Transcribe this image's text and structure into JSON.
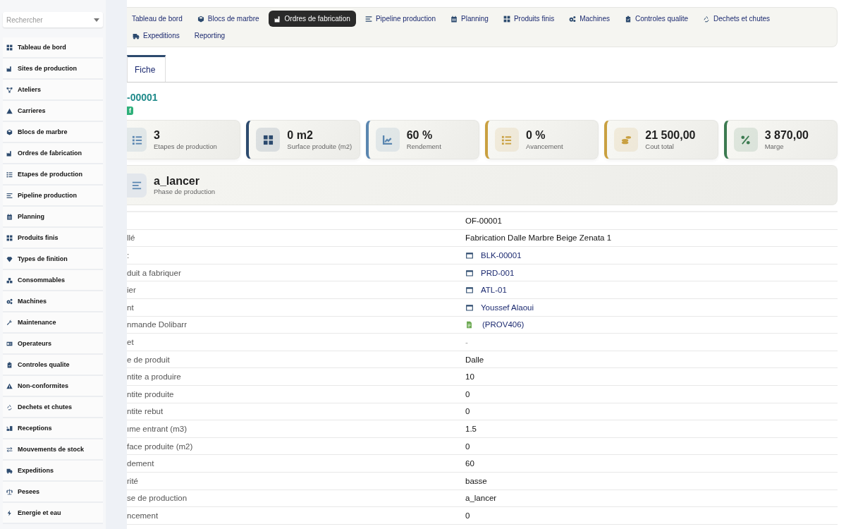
{
  "sidebar": {
    "search": {
      "placeholder": "Rechercher"
    },
    "items": [
      {
        "label": "Tableau de bord"
      },
      {
        "label": "Sites de production"
      },
      {
        "label": "Ateliers"
      },
      {
        "label": "Carrieres"
      },
      {
        "label": "Blocs de marbre"
      },
      {
        "label": "Ordres de fabrication"
      },
      {
        "label": "Etapes de production"
      },
      {
        "label": "Pipeline production"
      },
      {
        "label": "Planning"
      },
      {
        "label": "Produits finis"
      },
      {
        "label": "Types de finition"
      },
      {
        "label": "Consommables"
      },
      {
        "label": "Machines"
      },
      {
        "label": "Maintenance"
      },
      {
        "label": "Operateurs"
      },
      {
        "label": "Controles qualite"
      },
      {
        "label": "Non-conformites"
      },
      {
        "label": "Dechets et chutes"
      },
      {
        "label": "Receptions"
      },
      {
        "label": "Mouvements de stock"
      },
      {
        "label": "Expeditions"
      },
      {
        "label": "Pesees"
      },
      {
        "label": "Energie et eau"
      }
    ]
  },
  "nav": [
    {
      "label": "Tableau de bord",
      "selected": false
    },
    {
      "label": "Blocs de marbre",
      "selected": false
    },
    {
      "label": "Ordres de fabrication",
      "selected": true
    },
    {
      "label": "Pipeline production",
      "selected": false
    },
    {
      "label": "Planning",
      "selected": false
    },
    {
      "label": "Produits finis",
      "selected": false
    },
    {
      "label": "Machines",
      "selected": false
    },
    {
      "label": "Controles qualite",
      "selected": false
    },
    {
      "label": "Dechets et chutes",
      "selected": false
    },
    {
      "label": "Expeditions",
      "selected": false
    },
    {
      "label": "Reporting",
      "selected": false
    }
  ],
  "tabs": [
    {
      "label": "Fiche",
      "selected": true
    }
  ],
  "record": {
    "ref": "-00001",
    "badge": "f"
  },
  "stats": [
    {
      "value": "3",
      "label": "Etapes de production",
      "color": "#5a86b0"
    },
    {
      "value": "0 m2",
      "label": "Surface produite (m2)",
      "color": "#2c4a6e"
    },
    {
      "value": "60 %",
      "label": "Rendement",
      "color": "#5a86b0"
    },
    {
      "value": "0 %",
      "label": "Avancement",
      "color": "#c9a040"
    },
    {
      "value": "21 500,00",
      "label": "Cout total",
      "color": "#c9a040"
    },
    {
      "value": "3 870,00",
      "label": "Marge",
      "color": "#3b7a50"
    }
  ],
  "phase": {
    "value": "a_lancer",
    "label": "Phase de production"
  },
  "fields": [
    {
      "value": "OF-00001",
      "kind": "text"
    },
    {
      "label": "llé",
      "value": "Fabrication Dalle Marbre Beige Zenata 1",
      "kind": "text"
    },
    {
      "label": ":",
      "value": "BLK-00001",
      "kind": "link"
    },
    {
      "label": "duit a fabriquer",
      "value": "PRD-001",
      "kind": "link"
    },
    {
      "label": "ier",
      "value": "ATL-01",
      "kind": "link"
    },
    {
      "label": "nt",
      "value": "Youssef Alaoui",
      "kind": "link"
    },
    {
      "label": "nmande Dolibarr",
      "value": "(PROV406)",
      "kind": "doc"
    },
    {
      "label": "et",
      "value": "-",
      "kind": "empty"
    },
    {
      "label": "e de produit",
      "value": "Dalle",
      "kind": "text"
    },
    {
      "label": "ntite a produire",
      "value": "10",
      "kind": "text"
    },
    {
      "label": "ntite produite",
      "value": "0",
      "kind": "text"
    },
    {
      "label": "ntite rebut",
      "value": "0",
      "kind": "text"
    },
    {
      "label": "ıme entrant (m3)",
      "value": "1.5",
      "kind": "text"
    },
    {
      "label": "face produite (m2)",
      "value": "0",
      "kind": "text"
    },
    {
      "label": "dement",
      "value": "60",
      "kind": "text"
    },
    {
      "label": "rité",
      "value": "basse",
      "kind": "text"
    },
    {
      "label": "se de production",
      "value": "a_lancer",
      "kind": "text"
    },
    {
      "label": "ncement",
      "value": "0",
      "kind": "text"
    }
  ]
}
